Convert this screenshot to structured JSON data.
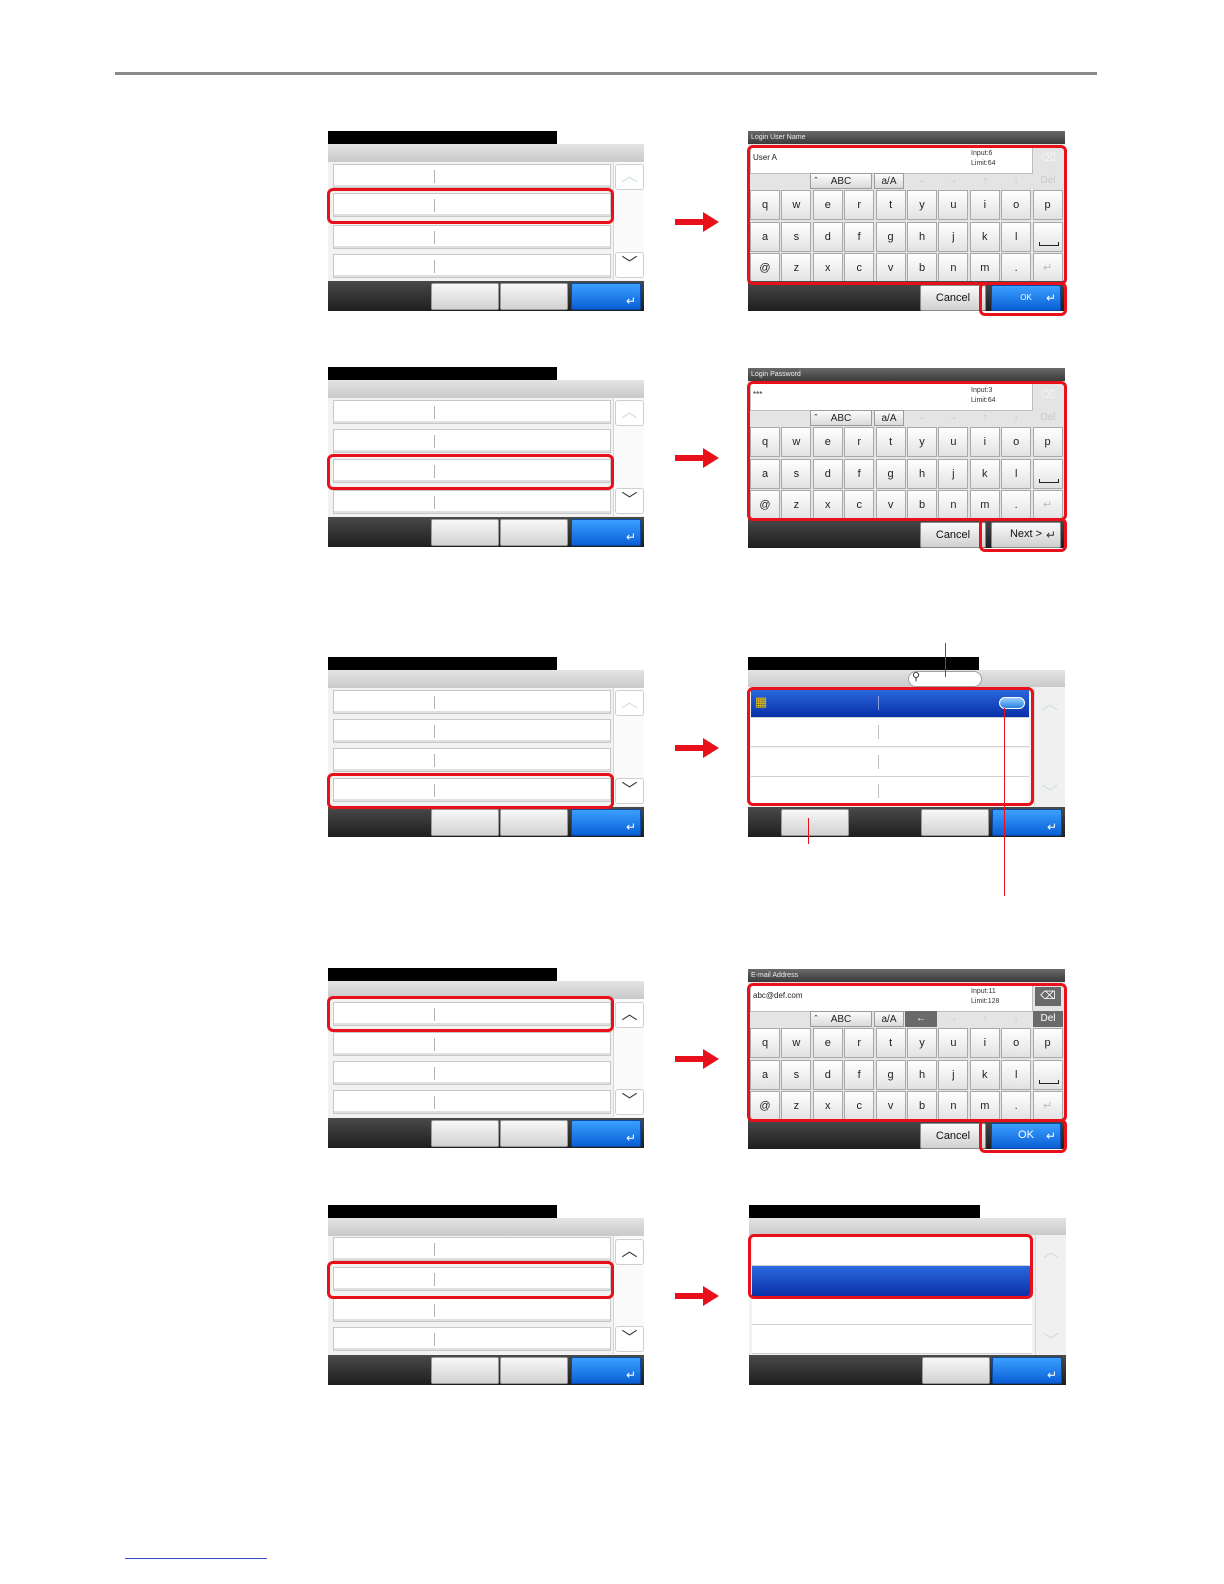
{
  "keyboard": {
    "row_top": {
      "case_label": "ABC",
      "shift_label": "a/A",
      "del_label": "Del"
    },
    "rows": [
      [
        "q",
        "w",
        "e",
        "r",
        "t",
        "y",
        "u",
        "i",
        "o",
        "p"
      ],
      [
        "a",
        "s",
        "d",
        "f",
        "g",
        "h",
        "j",
        "k",
        "l"
      ],
      [
        "@",
        "z",
        "x",
        "c",
        "v",
        "b",
        "n",
        "m",
        "."
      ]
    ],
    "cancel_label": "Cancel"
  },
  "step1": {
    "title": "Login User Name",
    "input_value": "User A",
    "input_count": "Input:6",
    "input_limit": "Limit:64",
    "ok_label": "OK"
  },
  "step2": {
    "title": "Login Password",
    "input_value": "***",
    "input_count": "Input:3",
    "input_limit": "Limit:64",
    "next_label": "Next >"
  },
  "step4": {
    "title": "E-mail Address",
    "input_value": "abc@def.com",
    "input_count": "Input:11",
    "input_limit": "Limit:128",
    "ok_label": "OK"
  },
  "colors": {
    "highlight": "#e8101a",
    "accent_blue": "#0a5fd6"
  }
}
